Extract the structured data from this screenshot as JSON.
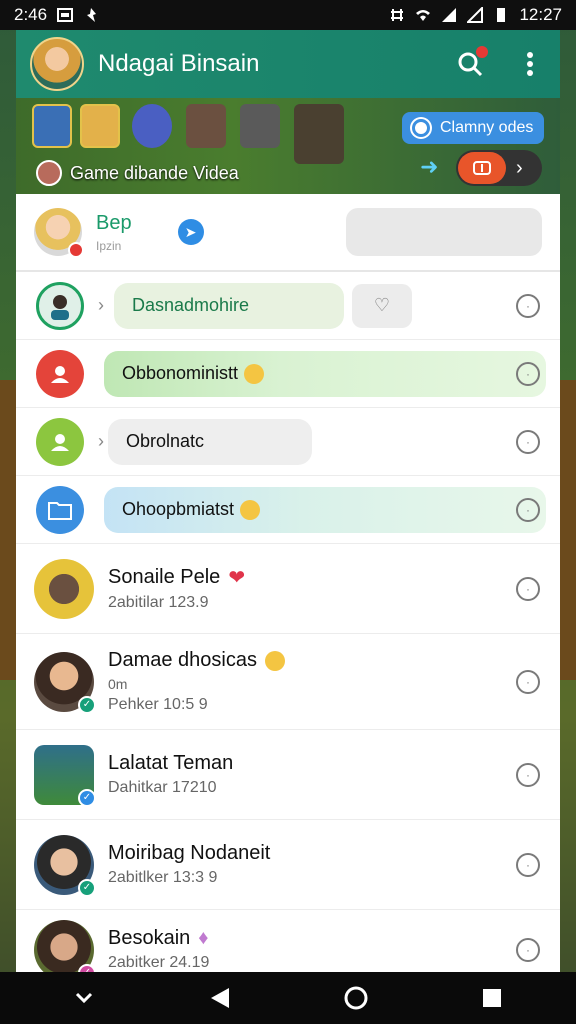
{
  "status_bar": {
    "time": "2:46",
    "clock": "12:27"
  },
  "app_bar": {
    "title": "Ndagai Binsain"
  },
  "banner": {
    "text": "Game dibande Videa",
    "pill_label": "Clamny odes"
  },
  "profile": {
    "name": "Bep",
    "sub": "Ipzin"
  },
  "bubble_rows": [
    {
      "text": "Dasnadmohire"
    },
    {
      "text": "Obbonoministt"
    },
    {
      "text": "Obrolnatc"
    },
    {
      "text": "Ohoopbmiatst"
    }
  ],
  "contacts": [
    {
      "name": "Sonaile Pele",
      "sub": "2abitilar 123.9",
      "sub2": ""
    },
    {
      "name": "Damae dhosicas",
      "sub": "Pehker 10:5 9",
      "sub2": "0m"
    },
    {
      "name": "Lalatat Teman",
      "sub": "Dahitkar 17210",
      "sub2": ""
    },
    {
      "name": "Moiribag Nodaneit",
      "sub": "2abitlker 13:3 9",
      "sub2": ""
    },
    {
      "name": "Besokain",
      "sub": "2abitker 24.19",
      "sub2": ""
    }
  ],
  "colors": {
    "app_bar": "#1f8a6e",
    "accent_green": "#1fa160",
    "accent_blue": "#2f8de4",
    "accent_red": "#e53935"
  }
}
